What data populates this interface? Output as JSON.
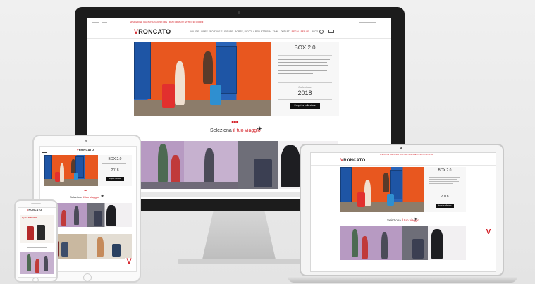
{
  "site": {
    "brand": "RONCATO",
    "promo_bar": "SPEDIZIONE GRATUITA IN 24/48 ORE - RESI GRATUITI ENTRO 30 GIORNI",
    "nav": [
      "VALIGIE",
      "LINEE SPORTIVE E LEISURE",
      "BORSE, PICCOLA PELLETTERIA",
      "ZAINI",
      "OUTLET",
      "REGALI PER LEI",
      "BLOG"
    ],
    "hero": {
      "title": "BOX 2.0",
      "collection_label": "Collezione",
      "year": "2018",
      "cta": "Scopri la collezione"
    },
    "section_title_prefix": "Seleziona ",
    "section_title_accent": "il tuo viaggio",
    "airplane_icon": "✈",
    "mobile_sale": "Up to 40% OFF",
    "colors": {
      "brand_red": "#d42027",
      "cta": "#111111",
      "hero_orange": "#e8571f",
      "hero_blue": "#2a64b8"
    }
  }
}
